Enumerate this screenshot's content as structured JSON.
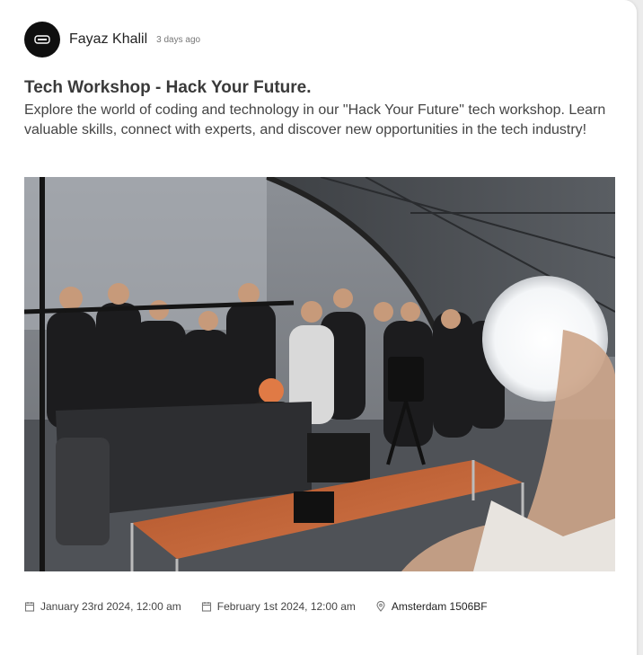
{
  "post": {
    "author": {
      "name": "Fayaz Khalil",
      "avatar_icon": "brand-logo-icon",
      "posted": "3 days ago"
    },
    "title": "Tech Workshop - Hack Your Future.",
    "description": "Explore the world of coding and technology in our \"Hack Your Future\" tech workshop. Learn valuable skills, connect with experts, and discover new opportunities in the tech industry!",
    "image_icon": "event-photo",
    "start": {
      "icon": "calendar-icon",
      "value": "January 23rd 2024, 12:00 am"
    },
    "end": {
      "icon": "calendar-icon",
      "value": "February 1st 2024, 12:00 am"
    },
    "location": {
      "icon": "location-pin-icon",
      "value": "Amsterdam 1506BF"
    }
  },
  "colors": {
    "card_background": "#ffffff",
    "page_background": "#ececec",
    "avatar": "#0f0f0f",
    "title": "#3a3a3a"
  }
}
